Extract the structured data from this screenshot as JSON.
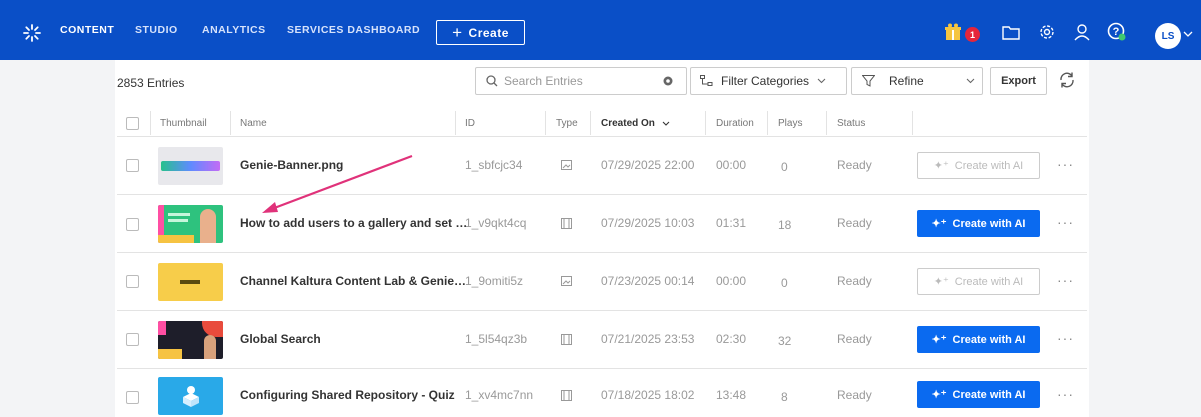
{
  "nav": {
    "content": "CONTENT",
    "studio": "STUDIO",
    "analytics": "ANALYTICS",
    "services_dashboard": "SERVICES DASHBOARD",
    "create": "Create",
    "notification_count": "1",
    "user_initials": "LS"
  },
  "toolbar": {
    "entries_count": "2853 Entries",
    "search_placeholder": "Search Entries",
    "filter_label": "Filter Categories",
    "refine_label": "Refine",
    "export_label": "Export"
  },
  "table": {
    "headers": {
      "thumbnail": "Thumbnail",
      "name": "Name",
      "id": "ID",
      "type": "Type",
      "created_on": "Created On",
      "duration": "Duration",
      "plays": "Plays",
      "status": "Status"
    },
    "rows": [
      {
        "name": "Genie-Banner.png",
        "id": "1_sbfcjc34",
        "type": "image-icon",
        "created": "07/29/2025 22:00",
        "duration": "00:00",
        "plays": "0",
        "status": "Ready",
        "ai_label": "Create with AI",
        "ai_enabled": false
      },
      {
        "name": "How to add users to a gallery and set …",
        "id": "1_v9qkt4cq",
        "type": "video-icon",
        "created": "07/29/2025 10:03",
        "duration": "01:31",
        "plays": "18",
        "status": "Ready",
        "ai_label": "Create with AI",
        "ai_enabled": true
      },
      {
        "name": "Channel Kaltura Content Lab & Genie…",
        "id": "1_9omiti5z",
        "type": "image-icon",
        "created": "07/23/2025 00:14",
        "duration": "00:00",
        "plays": "0",
        "status": "Ready",
        "ai_label": "Create with AI",
        "ai_enabled": false
      },
      {
        "name": "Global Search",
        "id": "1_5l54qz3b",
        "type": "video-icon",
        "created": "07/21/2025 23:53",
        "duration": "02:30",
        "plays": "32",
        "status": "Ready",
        "ai_label": "Create with AI",
        "ai_enabled": true
      },
      {
        "name": "Configuring Shared Repository - Quiz",
        "id": "1_xv4mc7nn",
        "type": "video-icon",
        "created": "07/18/2025 18:02",
        "duration": "13:48",
        "plays": "8",
        "status": "Ready",
        "ai_label": "Create with AI",
        "ai_enabled": true
      }
    ]
  },
  "colors": {
    "nav_bg": "#0a4fc7",
    "ai_button": "#0a6af0",
    "annotation_arrow": "#e0327a",
    "badge": "#e5253a"
  }
}
